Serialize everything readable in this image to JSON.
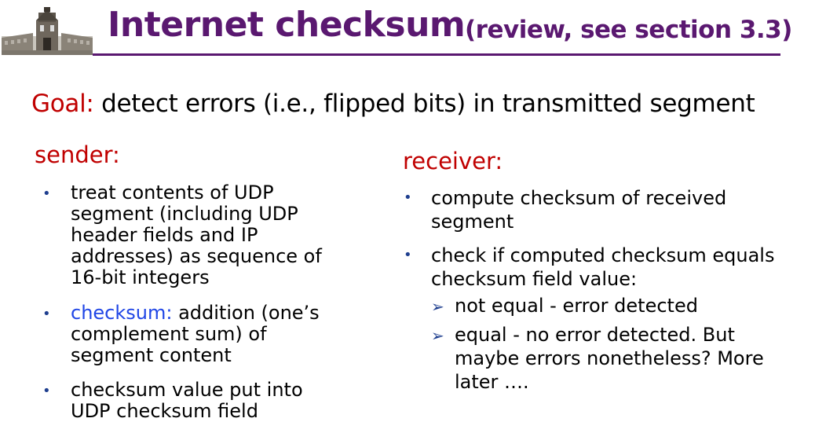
{
  "slide": {
    "title": "Internet checksum",
    "subtitle": "(review, see section 3.3)",
    "goal_label": "Goal:",
    "goal_text": " detect errors (i.e., flipped bits) in transmitted segment"
  },
  "sender": {
    "heading": "sender:",
    "bullet1": [
      "treat contents of UDP",
      "segment (including UDP",
      "header fields and IP",
      "addresses) as sequence of",
      "16-bit integers"
    ],
    "bullet2_highlight": "checksum:",
    "bullet2_rest": " addition (one’s",
    "bullet2_lines": [
      "complement sum) of",
      "segment content"
    ],
    "bullet3": [
      "checksum value put into",
      "UDP checksum field"
    ]
  },
  "receiver": {
    "heading": "receiver:",
    "bullet1": [
      "compute checksum of received",
      "segment"
    ],
    "bullet2": [
      "check if computed checksum equals",
      "checksum field value:"
    ],
    "sub1": [
      "not equal - error detected"
    ],
    "sub2": [
      "equal - no error detected. But",
      "maybe errors nonetheless? More",
      "later …."
    ]
  },
  "icons": {
    "logo": "university-building-logo",
    "bullet": "bullet-dot",
    "sub_bullet": "arrow-bullet"
  }
}
